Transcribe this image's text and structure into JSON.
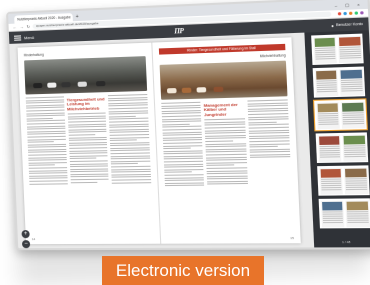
{
  "browser": {
    "tab_title": "Nutztierpraxis Aktuell 2020 - Ausgabe",
    "tab_close": "×",
    "new_tab": "+",
    "window_controls": "– ▢ ×",
    "url": "epaper.nutztierpraxis-aktuell.de/2020/ausgabe",
    "back": "←",
    "forward": "→",
    "reload": "↻",
    "extension_colors": [
      "#e74c3c",
      "#3498db",
      "#e67e22",
      "#2ecc71",
      "#9b59b6"
    ]
  },
  "app": {
    "menu_label": "Menü",
    "logo": "ΠΡ",
    "user_label": "Benutzer Konto"
  },
  "spread": {
    "left_label": "Rinderhaltung",
    "right_label": "Milchviehhaltung",
    "left_headline": "Tiergesundheit und Leistung im Milchviehbetrieb",
    "right_banner": "Rinder: Tiergesundheit und Fütterung im Stall",
    "right_headline": "Management der Kälber und Jungrinder",
    "left_page_num": "14",
    "right_page_num": "15"
  },
  "thumbnails": {
    "count_label": "1 / 48",
    "image_colors": [
      "#6b8e4e",
      "#b1563a",
      "#8a6b4a",
      "#4f6f8f",
      "#a38b5b",
      "#5d7a52",
      "#9c4a3c"
    ]
  },
  "zoom": {
    "in": "+",
    "out": "−"
  },
  "badge": {
    "label": "Electronic version"
  },
  "colors": {
    "accent": "#e8742a",
    "header": "#3a3d42",
    "red": "#c0392b"
  }
}
